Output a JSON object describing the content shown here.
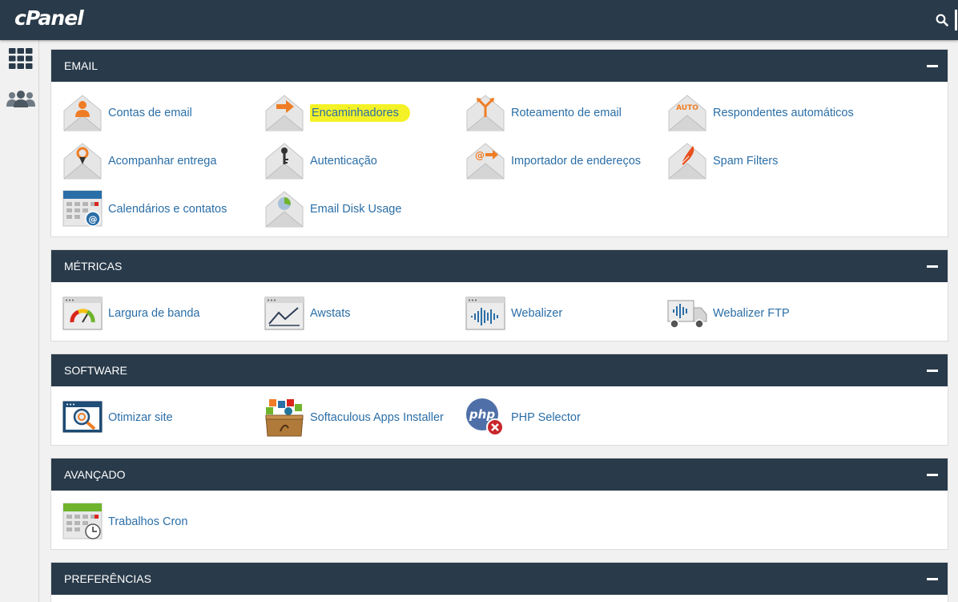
{
  "app": {
    "logo": "cPanel"
  },
  "colors": {
    "header": "#293a4a",
    "link": "#2a6ea7",
    "highlight": "#f4f226"
  },
  "sidebar": [
    {
      "icon": "grid-icon"
    },
    {
      "icon": "users-icon"
    }
  ],
  "sections": {
    "email": {
      "title": "EMAIL",
      "items": [
        {
          "label": "Contas de email",
          "icon": "email-accounts-icon"
        },
        {
          "label": "Encaminhadores",
          "icon": "forwarders-icon",
          "highlighted": true
        },
        {
          "label": "Roteamento de email",
          "icon": "email-routing-icon"
        },
        {
          "label": "Respondentes automáticos",
          "icon": "autoresponders-icon",
          "icon_text": "AUTO"
        },
        {
          "label": "Acompanhar entrega",
          "icon": "track-delivery-icon"
        },
        {
          "label": "Autenticação",
          "icon": "authentication-icon"
        },
        {
          "label": "Importador de endereços",
          "icon": "address-importer-icon",
          "icon_text": "@"
        },
        {
          "label": "Spam Filters",
          "icon": "spam-filters-icon"
        },
        {
          "label": "Calendários e contatos",
          "icon": "calendars-contacts-icon"
        },
        {
          "label": "Email Disk Usage",
          "icon": "email-disk-usage-icon"
        }
      ]
    },
    "metrics": {
      "title": "MÉTRICAS",
      "items": [
        {
          "label": "Largura de banda",
          "icon": "bandwidth-icon"
        },
        {
          "label": "Awstats",
          "icon": "awstats-icon"
        },
        {
          "label": "Webalizer",
          "icon": "webalizer-icon"
        },
        {
          "label": "Webalizer FTP",
          "icon": "webalizer-ftp-icon"
        }
      ]
    },
    "software": {
      "title": "SOFTWARE",
      "items": [
        {
          "label": "Otimizar site",
          "icon": "optimize-website-icon"
        },
        {
          "label": "Softaculous Apps Installer",
          "icon": "softaculous-icon"
        },
        {
          "label": "PHP Selector",
          "icon": "php-selector-icon",
          "icon_text": "php"
        }
      ]
    },
    "advanced": {
      "title": "AVANÇADO",
      "items": [
        {
          "label": "Trabalhos Cron",
          "icon": "cron-jobs-icon"
        }
      ]
    },
    "preferences": {
      "title": "PREFERÊNCIAS"
    }
  }
}
